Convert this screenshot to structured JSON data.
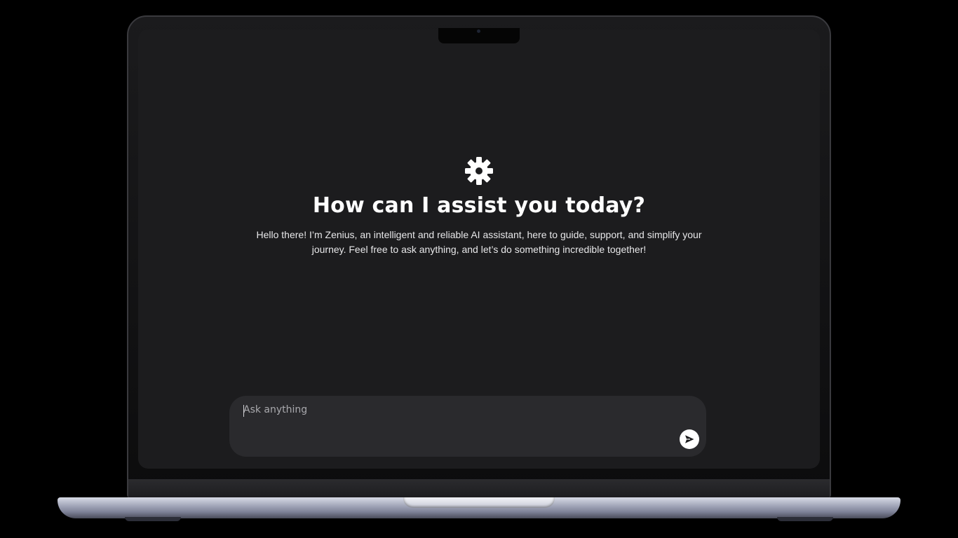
{
  "hero": {
    "icon": "gear-icon",
    "title": "How can I assist you today?",
    "subtitle": "Hello there! I’m Zenius, an intelligent and reliable AI assistant, here to guide, support, and simplify your journey. Feel free to ask anything, and let’s do something incredible together!"
  },
  "composer": {
    "placeholder": "Ask anything",
    "value": "",
    "send_icon": "send-icon"
  },
  "colors": {
    "background": "#000000",
    "screen": "#1c1c1e",
    "composer": "#2a2a2d",
    "text": "#ffffff"
  }
}
